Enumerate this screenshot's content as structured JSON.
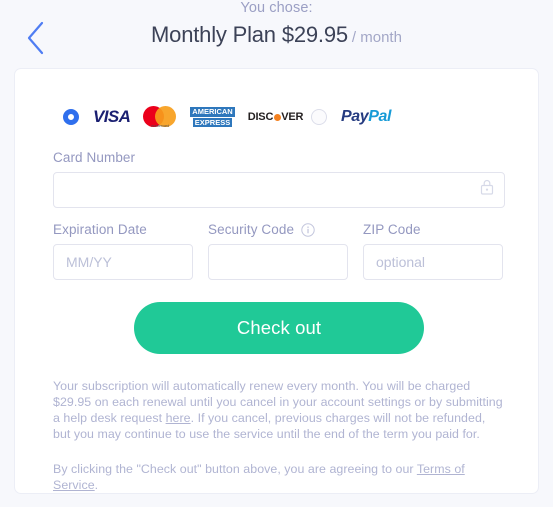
{
  "header": {
    "back_icon": "chevron-left-icon",
    "chose_label": "You chose:",
    "plan_name": "Monthly Plan",
    "plan_price": "$29.95",
    "plan_period": "/ month"
  },
  "payment_methods": {
    "card_option": {
      "selected": true,
      "logos": [
        {
          "name": "visa-logo",
          "text": "VISA"
        },
        {
          "name": "mastercard-logo",
          "text": "mastercard"
        },
        {
          "name": "amex-logo",
          "line1": "AMERICAN",
          "line2": "EXPRESS"
        },
        {
          "name": "discover-logo",
          "part1": "DISC",
          "part2": "VER"
        }
      ]
    },
    "paypal_option": {
      "selected": false,
      "label_pay": "Pay",
      "label_pal": "Pal"
    }
  },
  "form": {
    "card_number": {
      "label": "Card Number",
      "value": "",
      "placeholder": "",
      "icon": "lock-icon"
    },
    "expiration": {
      "label": "Expiration Date",
      "value": "",
      "placeholder": "MM/YY"
    },
    "security_code": {
      "label": "Security Code",
      "value": "",
      "placeholder": "",
      "icon": "info-icon"
    },
    "zip": {
      "label": "ZIP Code",
      "value": "",
      "placeholder": "optional"
    }
  },
  "checkout": {
    "label": "Check out",
    "color": "#20c997"
  },
  "fine_print": {
    "renewal_part1": "Your subscription will automatically renew every month. You will be charged $29.95 on each renewal until you cancel in your account settings or by submitting a help desk request ",
    "renewal_link": "here",
    "renewal_part2": ". If you cancel, previous charges will not be refunded, but you may continue to use the service until the end of the term you paid for.",
    "terms_part1": "By clicking the \"Check out\" button above, you are agreeing to our ",
    "terms_link": "Terms of Service",
    "terms_part2": "."
  }
}
